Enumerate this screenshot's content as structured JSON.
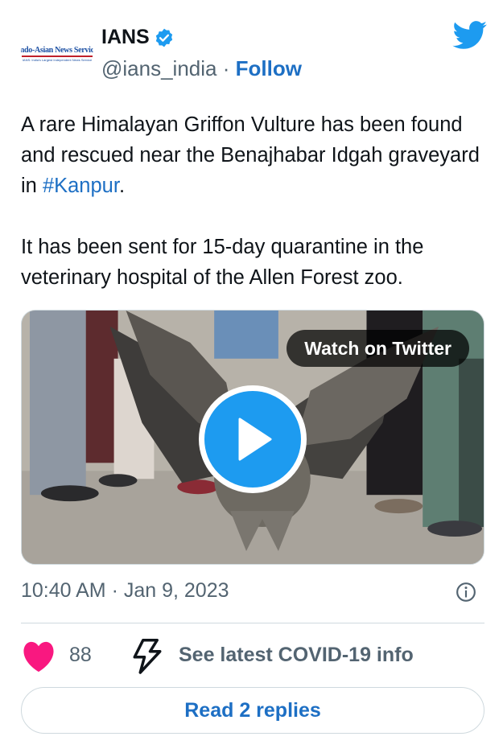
{
  "author": {
    "name": "IANS",
    "handle": "@ians_india",
    "separator": "·",
    "follow_label": "Follow",
    "avatar_logo_text": "Indo-Asian News Service",
    "avatar_logo_subtext": "IANS: India's Largest Independent News Service",
    "verified": true
  },
  "tweet": {
    "text_line1_before_hashtag": "A rare Himalayan Griffon Vulture has been found and rescued near the Benajhabar Idgah graveyard in ",
    "hashtag": "#Kanpur",
    "text_line1_after_hashtag": ".",
    "text_paragraph2": "It has been sent for 15-day quarantine in the veterinary hospital of the Allen Forest zoo."
  },
  "media": {
    "watch_label": "Watch on Twitter"
  },
  "meta": {
    "time": "10:40 AM",
    "separator": " · ",
    "date": "Jan 9, 2023"
  },
  "actions": {
    "like_count": "88",
    "covid_label": "See latest COVID-19 info"
  },
  "replies": {
    "label": "Read 2 replies"
  },
  "colors": {
    "link_blue": "#1d6fc4",
    "twitter_blue": "#1d9bf0",
    "like_pink": "#f91880",
    "secondary_text": "#536471"
  },
  "icons": [
    "verified-badge-icon",
    "twitter-bird-icon",
    "play-icon",
    "info-icon",
    "heart-icon",
    "bolt-icon"
  ]
}
